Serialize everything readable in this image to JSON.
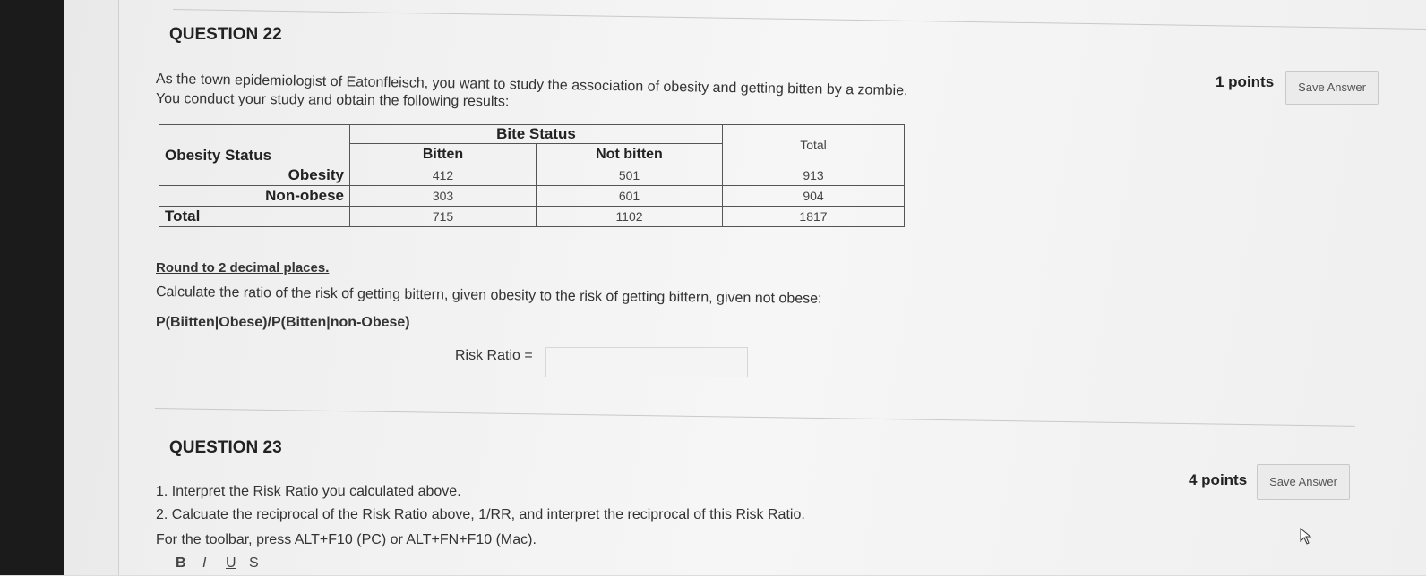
{
  "q22": {
    "title": "QUESTION 22",
    "intro_line1": "As the town epidemiologist of Eatonfleisch, you want to study the association of obesity and getting bitten by a zombie.",
    "intro_line2": "You conduct your study and obtain the following results:",
    "points": "1 points",
    "save_label": "Save Answer",
    "table": {
      "row_header": "Obesity Status",
      "col_group": "Bite Status",
      "col_bitten": "Bitten",
      "col_not_bitten": "Not bitten",
      "col_total": "Total",
      "rows": [
        {
          "label": "Obesity",
          "bitten": "412",
          "not_bitten": "501",
          "total": "913"
        },
        {
          "label": "Non-obese",
          "bitten": "303",
          "not_bitten": "601",
          "total": "904"
        },
        {
          "label": "Total",
          "bitten": "715",
          "not_bitten": "1102",
          "total": "1817"
        }
      ]
    },
    "round_note": "Round to 2 decimal places.",
    "instruction": "Calculate the ratio of the risk of getting bittern, given obesity to the risk of getting bittern, given not obese:",
    "formula": "P(Biitten|Obese)/P(Bitten|non-Obese)",
    "risk_label": "Risk Ratio =",
    "risk_value": ""
  },
  "q23": {
    "title": "QUESTION 23",
    "item1": "1. Interpret the Risk Ratio you calculated above.",
    "item2": "2. Calcuate the reciprocal of the Risk Ratio above, 1/RR, and interpret the reciprocal of this Risk Ratio.",
    "toolbar_hint": "For the toolbar, press ALT+F10 (PC) or ALT+FN+F10 (Mac).",
    "points": "4 points",
    "save_label": "Save Answer",
    "toolbar": [
      "B",
      "I",
      "U",
      "S"
    ]
  }
}
